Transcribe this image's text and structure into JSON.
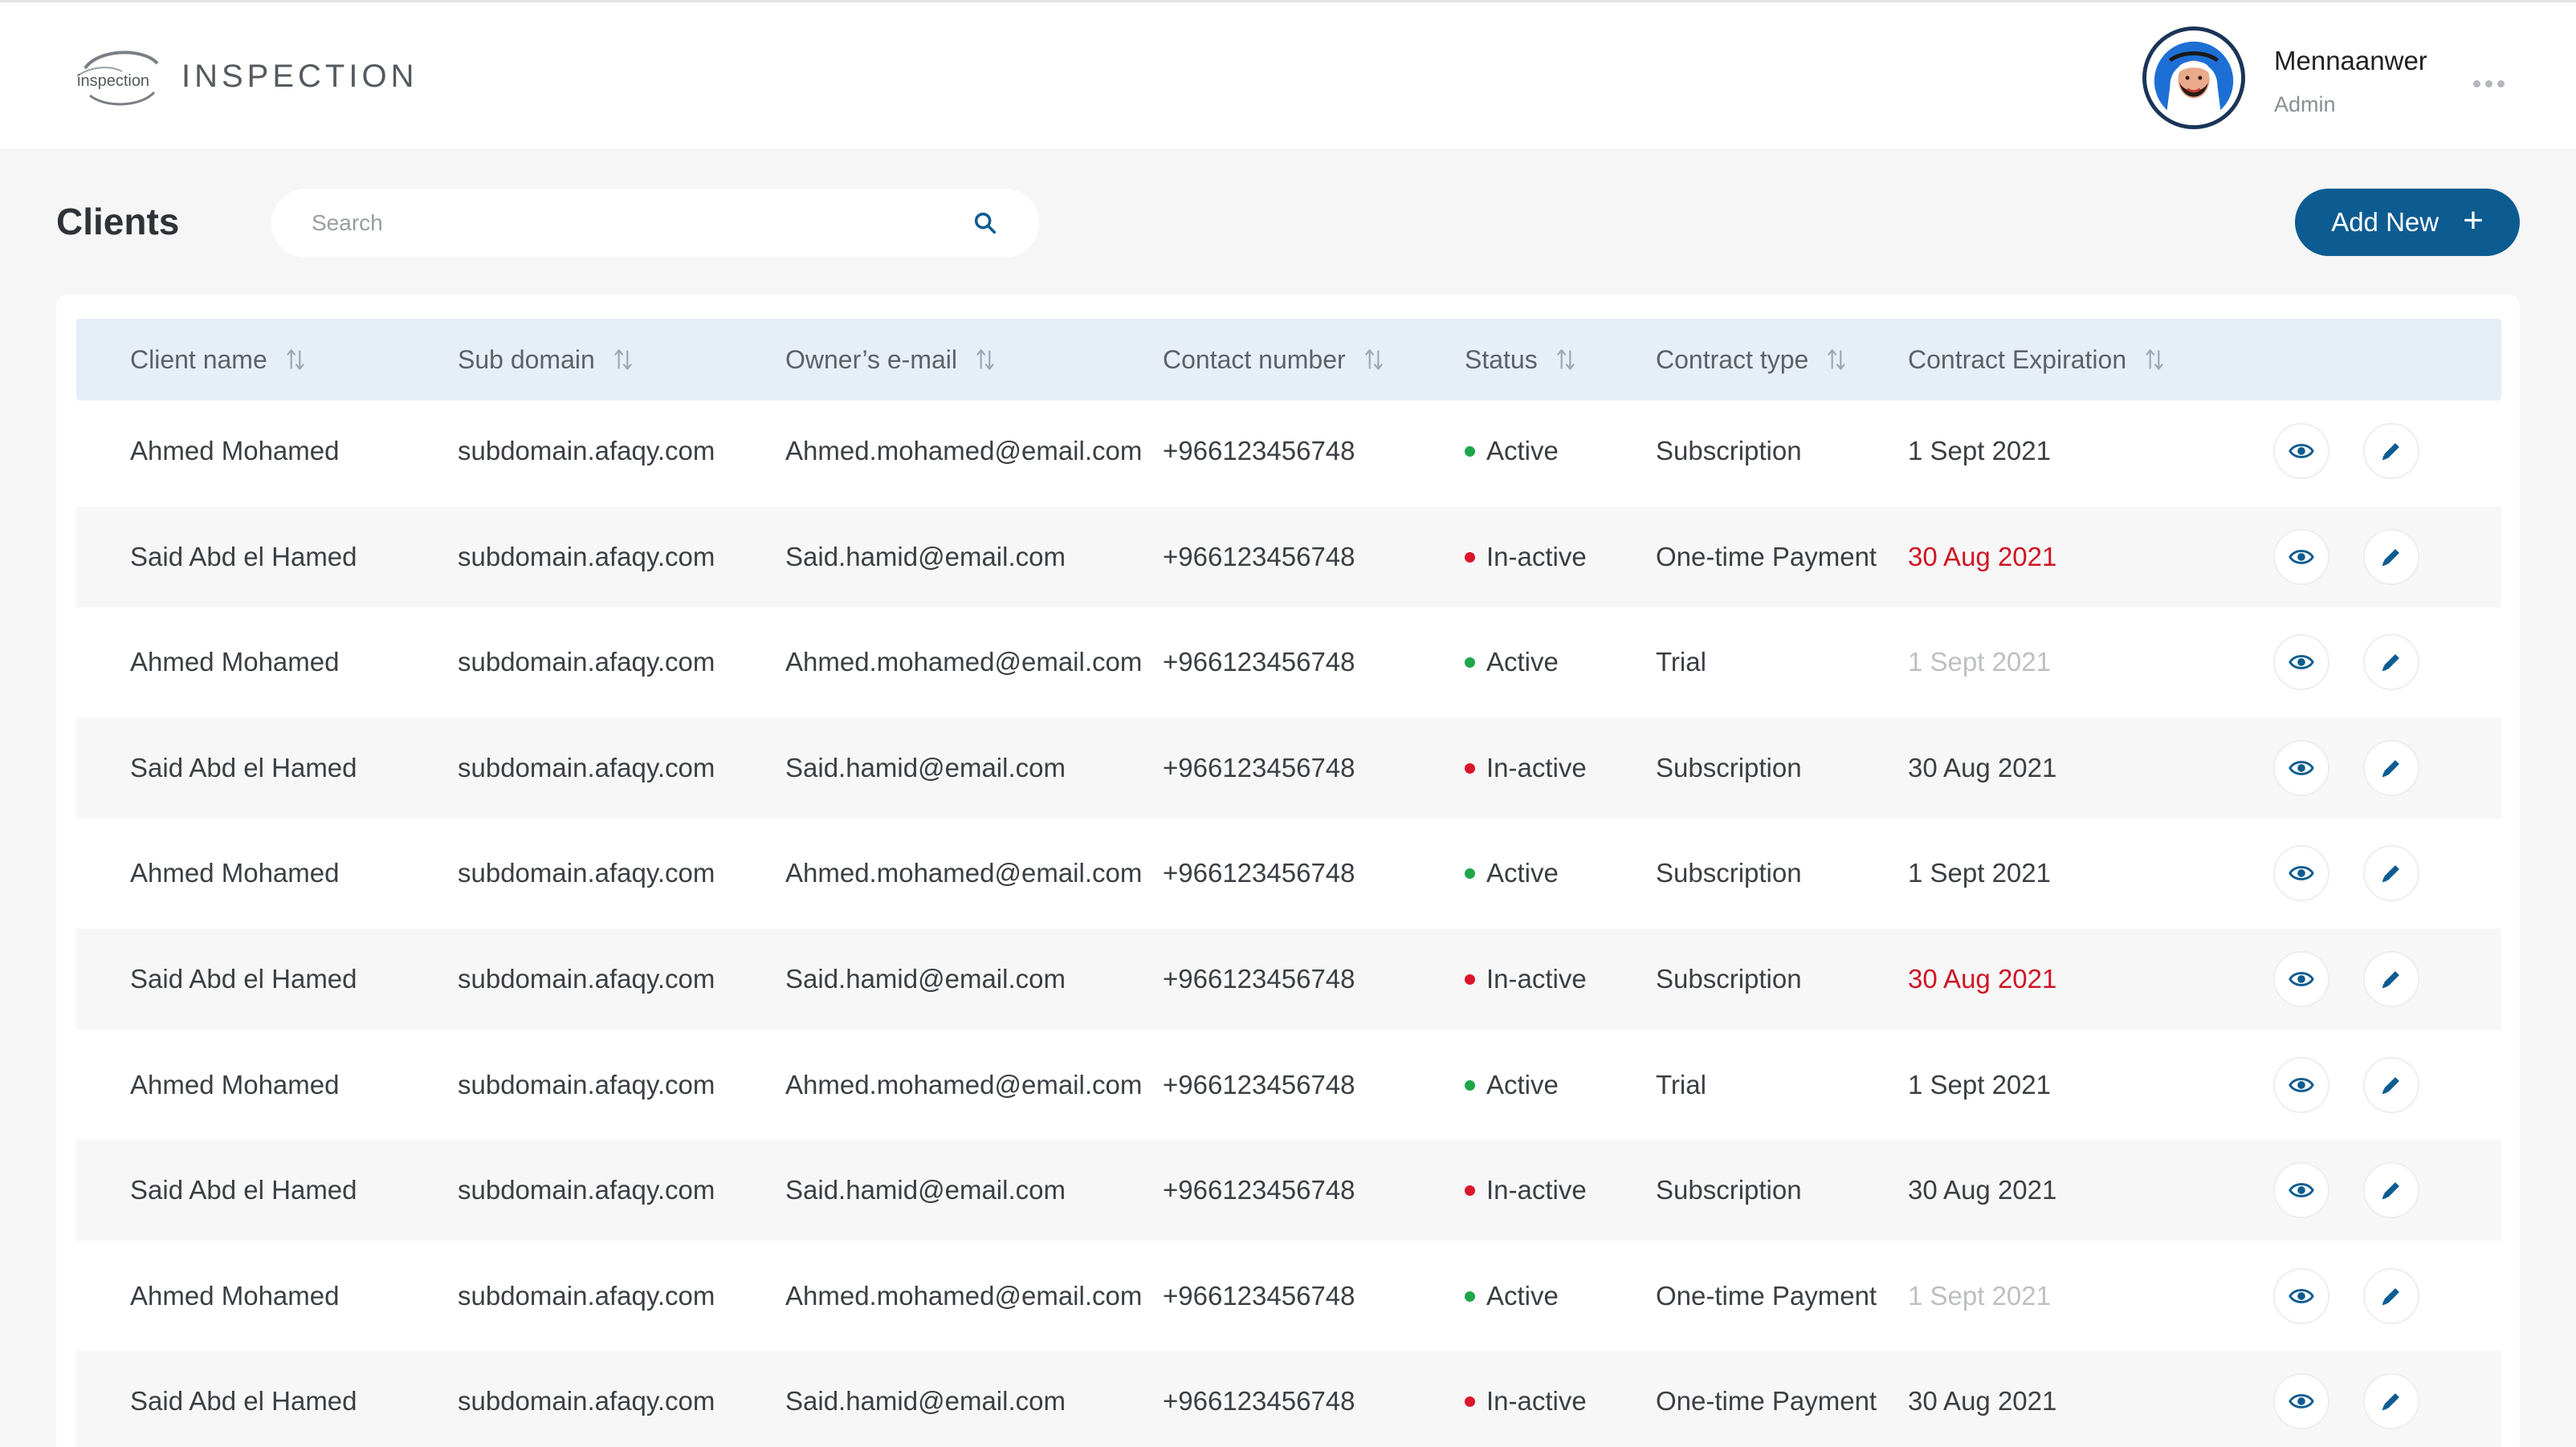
{
  "app": {
    "brand": "INSPECTION",
    "logo_text": "inspection"
  },
  "user": {
    "name": "Mennaanwer",
    "role": "Admin"
  },
  "toolbar": {
    "title": "Clients",
    "search_placeholder": "Search",
    "add_label": "Add New",
    "add_icon": "+"
  },
  "colors": {
    "primary": "#0d5c91",
    "active": "#1fa64a",
    "inactive": "#d9152b",
    "expired": "#cf1424",
    "header_bg": "#e6eef7"
  },
  "table": {
    "columns": [
      "Client name",
      "Sub domain",
      "Owner’s e-mail",
      "Contact number",
      "Status",
      "Contract type",
      "Contract Expiration"
    ],
    "rows": [
      {
        "name": "Ahmed Mohamed",
        "subdomain": "subdomain.afaqy.com",
        "email": "Ahmed.mohamed@email.com",
        "phone": "+966123456748",
        "status": "Active",
        "status_kind": "active",
        "contract": "Subscription",
        "expiration": "1 Sept 2021",
        "exp_state": "normal"
      },
      {
        "name": "Said Abd el Hamed",
        "subdomain": "subdomain.afaqy.com",
        "email": "Said.hamid@email.com",
        "phone": "+966123456748",
        "status": "In-active",
        "status_kind": "inactive",
        "contract": "One-time Payment",
        "expiration": "30 Aug 2021",
        "exp_state": "expired"
      },
      {
        "name": "Ahmed Mohamed",
        "subdomain": "subdomain.afaqy.com",
        "email": "Ahmed.mohamed@email.com",
        "phone": "+966123456748",
        "status": "Active",
        "status_kind": "active",
        "contract": "Trial",
        "expiration": "1 Sept 2021",
        "exp_state": "muted"
      },
      {
        "name": "Said Abd el Hamed",
        "subdomain": "subdomain.afaqy.com",
        "email": "Said.hamid@email.com",
        "phone": "+966123456748",
        "status": "In-active",
        "status_kind": "inactive",
        "contract": "Subscription",
        "expiration": "30 Aug 2021",
        "exp_state": "normal"
      },
      {
        "name": "Ahmed Mohamed",
        "subdomain": "subdomain.afaqy.com",
        "email": "Ahmed.mohamed@email.com",
        "phone": "+966123456748",
        "status": "Active",
        "status_kind": "active",
        "contract": "Subscription",
        "expiration": "1 Sept 2021",
        "exp_state": "normal"
      },
      {
        "name": "Said Abd el Hamed",
        "subdomain": "subdomain.afaqy.com",
        "email": "Said.hamid@email.com",
        "phone": "+966123456748",
        "status": "In-active",
        "status_kind": "inactive",
        "contract": "Subscription",
        "expiration": "30 Aug 2021",
        "exp_state": "expired"
      },
      {
        "name": "Ahmed Mohamed",
        "subdomain": "subdomain.afaqy.com",
        "email": "Ahmed.mohamed@email.com",
        "phone": "+966123456748",
        "status": "Active",
        "status_kind": "active",
        "contract": "Trial",
        "expiration": "1 Sept 2021",
        "exp_state": "normal"
      },
      {
        "name": "Said Abd el Hamed",
        "subdomain": "subdomain.afaqy.com",
        "email": "Said.hamid@email.com",
        "phone": "+966123456748",
        "status": "In-active",
        "status_kind": "inactive",
        "contract": "Subscription",
        "expiration": "30 Aug 2021",
        "exp_state": "normal"
      },
      {
        "name": "Ahmed Mohamed",
        "subdomain": "subdomain.afaqy.com",
        "email": "Ahmed.mohamed@email.com",
        "phone": "+966123456748",
        "status": "Active",
        "status_kind": "active",
        "contract": "One-time Payment",
        "expiration": "1 Sept 2021",
        "exp_state": "muted"
      },
      {
        "name": "Said Abd el Hamed",
        "subdomain": "subdomain.afaqy.com",
        "email": "Said.hamid@email.com",
        "phone": "+966123456748",
        "status": "In-active",
        "status_kind": "inactive",
        "contract": "One-time Payment",
        "expiration": "30 Aug 2021",
        "exp_state": "normal"
      }
    ],
    "row_actions": [
      "eye-icon",
      "pencil-icon"
    ]
  }
}
